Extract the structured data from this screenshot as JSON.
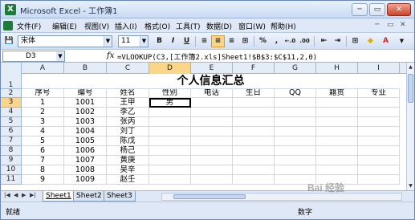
{
  "window": {
    "title": "Microsoft Excel - 工作簿1",
    "minimize": "─",
    "restore": "▭",
    "close": "✕"
  },
  "menu": {
    "items": [
      "文件(F)",
      "编辑(E)",
      "视图(V)",
      "插入(I)",
      "格式(O)",
      "工具(T)",
      "数据(D)",
      "窗口(W)",
      "帮助(H)"
    ],
    "controls": [
      "─",
      "▭",
      "✕"
    ]
  },
  "toolbar": {
    "font_name": "宋体",
    "font_size": "11",
    "bold": "B",
    "italic": "I",
    "underline": "U",
    "percent": "%",
    "comma": ",",
    "inc_decimal": "←.0",
    "dec_decimal": ".00",
    "font_color_label": "A",
    "alignment_active": "center"
  },
  "formula_bar": {
    "name_box": "D3",
    "fx": "fx",
    "formula": "=VLOOKUP(C3,[工作簿2.xls]Sheet1!$B$3:$C$11,2,0)"
  },
  "grid": {
    "columns": [
      "A",
      "B",
      "C",
      "D",
      "E",
      "F",
      "G",
      "H",
      "I"
    ],
    "selected_column": "D",
    "rows": [
      "1",
      "2",
      "3",
      "4",
      "5",
      "6",
      "7",
      "8",
      "9",
      "10",
      "11"
    ],
    "selected_row": "3",
    "title": "个人信息汇总",
    "headers": [
      "序号",
      "编号",
      "姓名",
      "性别",
      "电话",
      "生日",
      "QQ",
      "籍贯",
      "专业"
    ],
    "data": [
      [
        "1",
        "1001",
        "王甲",
        "男"
      ],
      [
        "2",
        "1002",
        "李乙",
        ""
      ],
      [
        "3",
        "1003",
        "张丙",
        ""
      ],
      [
        "4",
        "1004",
        "刘丁",
        ""
      ],
      [
        "5",
        "1005",
        "陈戊",
        ""
      ],
      [
        "6",
        "1006",
        "杨己",
        ""
      ],
      [
        "7",
        "1007",
        "黄庚",
        ""
      ],
      [
        "8",
        "1008",
        "吴辛",
        ""
      ],
      [
        "9",
        "1009",
        "赵壬",
        ""
      ]
    ]
  },
  "sheets": {
    "nav": [
      "|◀",
      "◀",
      "▶",
      "▶|"
    ],
    "tabs": [
      "Sheet1",
      "Sheet2",
      "Sheet3"
    ],
    "active": "Sheet1"
  },
  "watermark": "Bai 经验",
  "status": {
    "left": "就绪",
    "right": "数字"
  },
  "colors": {
    "accent": "#f9d68a",
    "window_bg": "#dfe8f6",
    "header_bg": "#e4ecf7",
    "gridline": "#d0d7e5"
  }
}
